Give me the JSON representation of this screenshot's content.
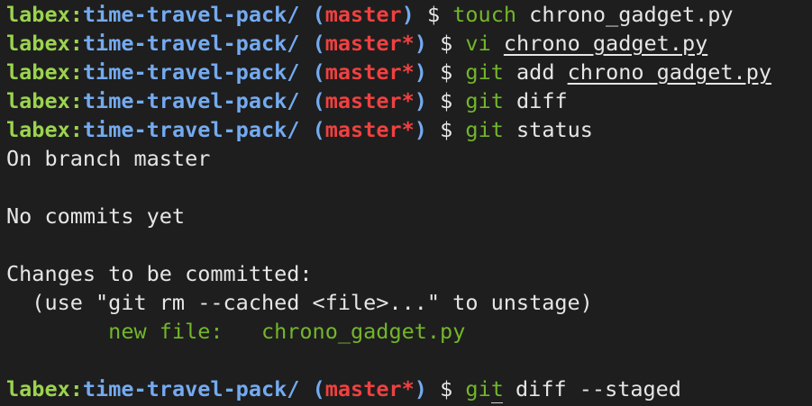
{
  "prompt": {
    "user": "labex",
    "sep": ":",
    "path": "time-travel-pack/",
    "paren_open": "(",
    "paren_close": ")",
    "dollar": "$"
  },
  "lines": [
    {
      "branch": "master",
      "cmd": "touch",
      "arg": "chrono_gadget.py"
    },
    {
      "branch": "master*",
      "cmd": "vi",
      "arg": "chrono_gadget.py"
    },
    {
      "branch": "master*",
      "cmd": "git",
      "arg": "add chrono_gadget.py"
    },
    {
      "branch": "master*",
      "cmd": "git",
      "arg": "diff"
    },
    {
      "branch": "master*",
      "cmd": "git",
      "arg": "status"
    }
  ],
  "output": {
    "on_branch": "On branch master",
    "no_commits": "No commits yet",
    "changes_header": "Changes to be committed:",
    "hint": "  (use \"git rm --cached <file>...\" to unstage)",
    "new_file_label": "        new file:   ",
    "new_file_name": "chrono_gadget.py"
  },
  "current": {
    "branch": "master*",
    "cmd": "git",
    "arg": "diff --staged"
  }
}
